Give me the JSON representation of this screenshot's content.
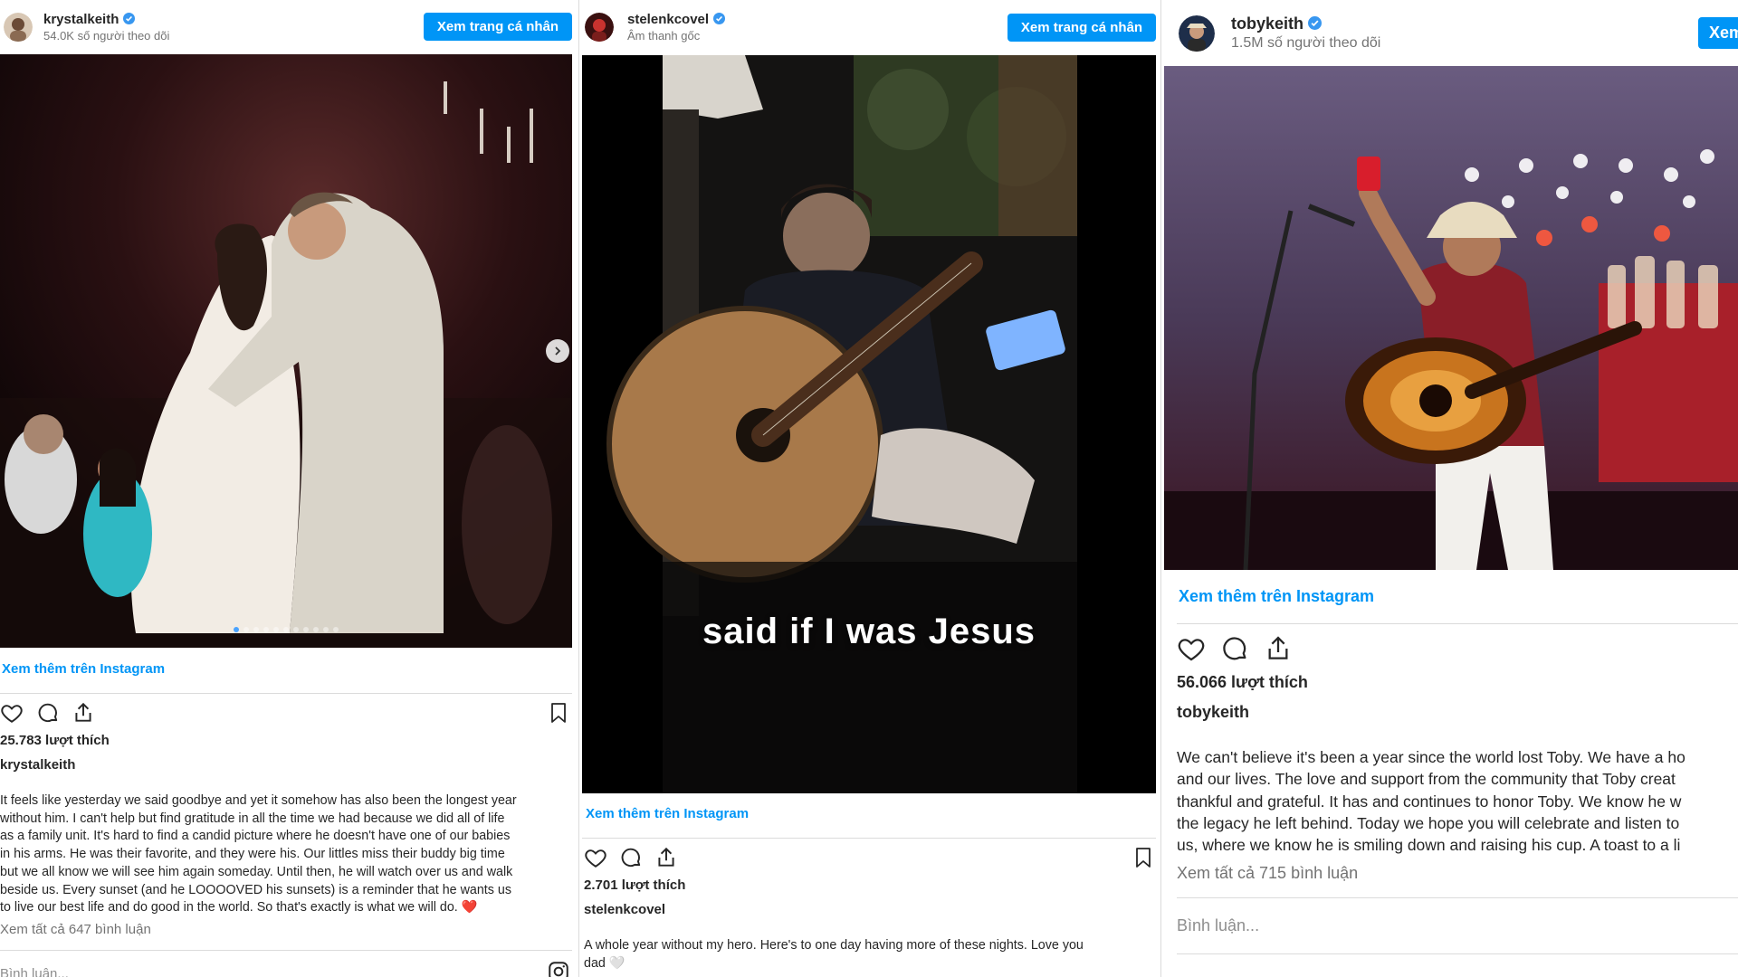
{
  "colors": {
    "accent": "#0095f6",
    "verified": "#3897f0",
    "heart": "#ed4956"
  },
  "posts": [
    {
      "username": "krystalkeith",
      "subline": "54.0K số người theo dõi",
      "view_profile": "Xem trang cá nhân",
      "carousel_pages": 11,
      "carousel_current": 1,
      "more_link": "Xem thêm trên Instagram",
      "likes": "25.783 lượt thích",
      "caption_user": "krystalkeith",
      "caption": "It feels like yesterday we said goodbye and yet it somehow has also been the longest year\nwithout him. I can't help but find gratitude in all the time we had because we did all of life\nas a family unit. It's hard to find a candid picture where he doesn't have one of our babies\nin his arms. He was their favorite, and they were his. Our littles miss their buddy big time\nbut we all know we will see him again someday. Until then, he will watch over us and walk\nbeside us. Every sunset (and he LOOOOVED his sunsets) is a reminder that he wants us\nto live our best life and do good in the world. So that's exactly is what we will do.",
      "caption_emoji": "❤️",
      "all_comments": "Xem tất cả 647 bình luận",
      "comment_placeholder": "Bình luận..."
    },
    {
      "username": "stelenkcovel",
      "subline": "Âm thanh gốc",
      "view_profile": "Xem trang cá nhân",
      "video_subtitle": "said if I was Jesus",
      "more_link": "Xem thêm trên Instagram",
      "likes": "2.701 lượt thích",
      "caption_user": "stelenkcovel",
      "caption": "A whole year without my hero. Here's to one day having more of these nights. Love you\ndad",
      "caption_emoji": "🤍"
    },
    {
      "username": "tobykeith",
      "subline": "1.5M số người theo dõi",
      "view_profile": "Xem",
      "more_link": "Xem thêm trên Instagram",
      "likes": "56.066 lượt thích",
      "caption_user": "tobykeith",
      "caption": "We can't believe it's been a year since the world lost Toby. We have a ho\nand our lives. The love and support from the community that Toby creat\nthankful and grateful. It has and continues to honor Toby. We know he w\nthe legacy he left behind. Today we hope you will celebrate and listen to\nus, where we know he is smiling down and raising his cup. A toast to a li",
      "all_comments": "Xem tất cả 715 bình luận",
      "comment_placeholder": "Bình luận..."
    }
  ]
}
